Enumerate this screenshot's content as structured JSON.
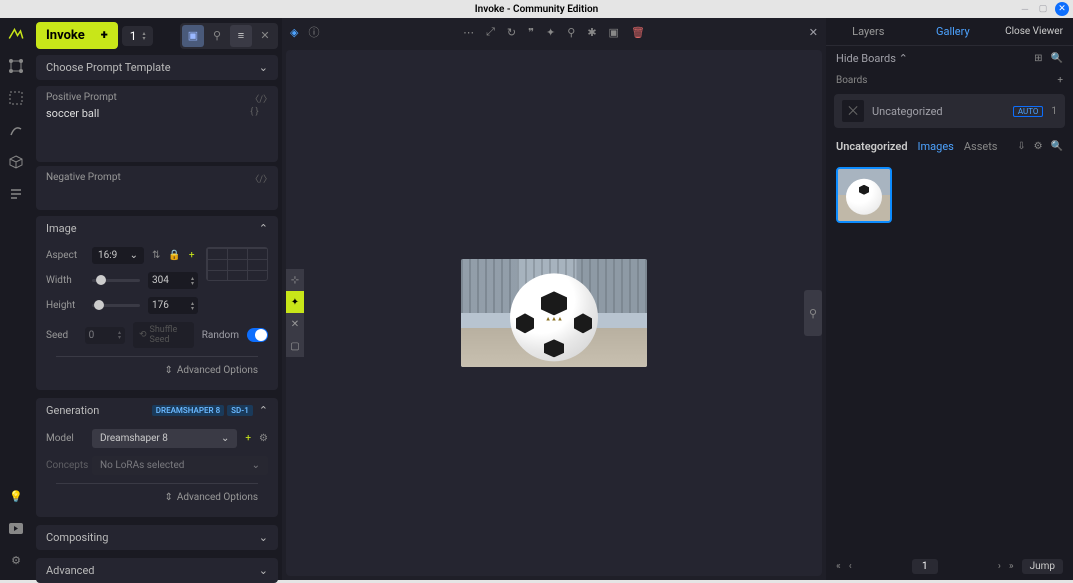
{
  "window": {
    "title": "Invoke - Community Edition"
  },
  "invoke": {
    "label": "Invoke",
    "count": "1"
  },
  "template": {
    "label": "Choose Prompt Template"
  },
  "prompts": {
    "positive_label": "Positive Prompt",
    "positive_value": "soccer ball",
    "negative_label": "Negative Prompt"
  },
  "image": {
    "section": "Image",
    "aspect_label": "Aspect",
    "aspect_value": "16:9",
    "width_label": "Width",
    "width_value": "304",
    "height_label": "Height",
    "height_value": "176",
    "seed_label": "Seed",
    "seed_value": "0",
    "shuffle": "Shuffle Seed",
    "random": "Random",
    "advanced": "Advanced Options"
  },
  "generation": {
    "section": "Generation",
    "badge1": "DREAMSHAPER 8",
    "badge2": "SD-1",
    "model_label": "Model",
    "model_value": "Dreamshaper 8",
    "concepts_label": "Concepts",
    "concepts_placeholder": "No LoRAs selected",
    "advanced": "Advanced Options"
  },
  "compositing": {
    "label": "Compositing"
  },
  "advanced": {
    "label": "Advanced"
  },
  "right": {
    "layers_tab": "Layers",
    "gallery_tab": "Gallery",
    "close": "Close Viewer",
    "hide_boards": "Hide Boards",
    "boards": "Boards",
    "board_name": "Uncategorized",
    "auto": "AUTO",
    "board_count": "1",
    "gallery_title": "Uncategorized",
    "images_tab": "Images",
    "assets_tab": "Assets",
    "page": "1",
    "jump": "Jump"
  }
}
